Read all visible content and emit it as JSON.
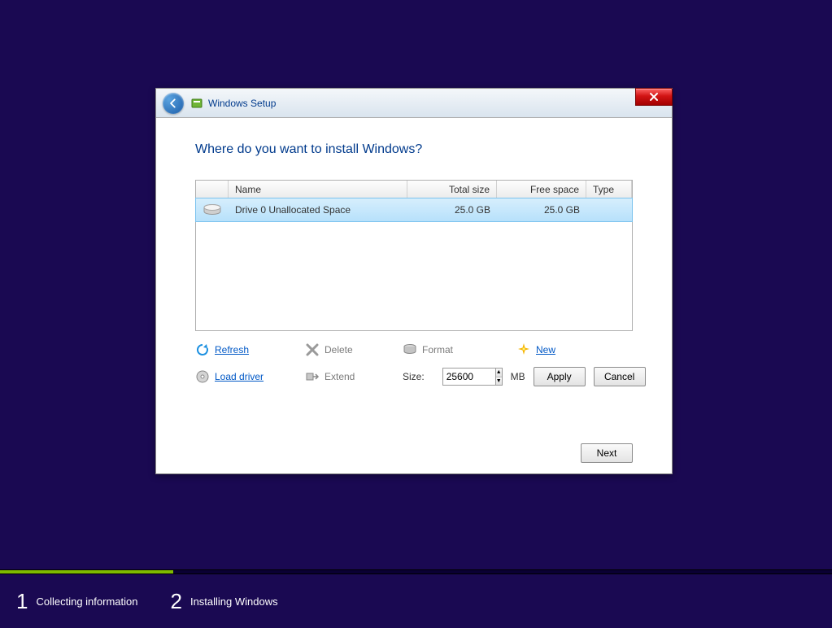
{
  "titlebar": {
    "title": "Windows Setup"
  },
  "heading": "Where do you want to install Windows?",
  "columns": {
    "name": "Name",
    "total": "Total size",
    "free": "Free space",
    "type": "Type"
  },
  "drives": [
    {
      "name": "Drive 0 Unallocated Space",
      "total": "25.0 GB",
      "free": "25.0 GB",
      "type": ""
    }
  ],
  "actions": {
    "refresh": "Refresh",
    "delete": "Delete",
    "format": "Format",
    "new": "New",
    "load_driver": "Load driver",
    "extend": "Extend"
  },
  "size": {
    "label": "Size:",
    "value": "25600",
    "unit": "MB"
  },
  "buttons": {
    "apply": "Apply",
    "cancel": "Cancel",
    "next": "Next"
  },
  "steps": {
    "s1_num": "1",
    "s1_label": "Collecting information",
    "s2_num": "2",
    "s2_label": "Installing Windows"
  }
}
